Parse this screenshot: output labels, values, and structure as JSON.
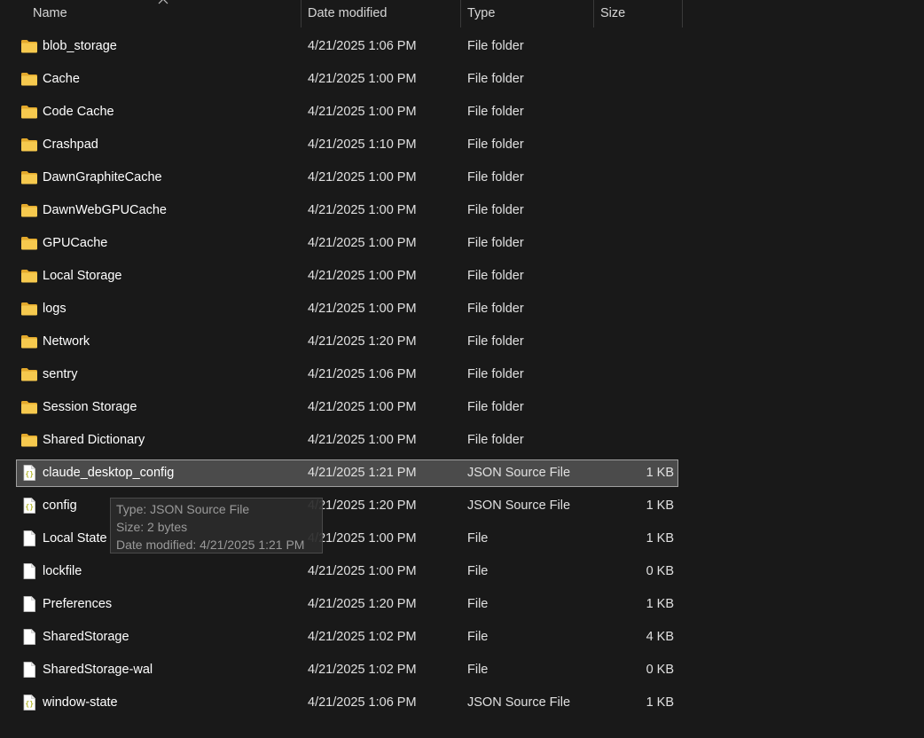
{
  "columns": {
    "name": "Name",
    "date": "Date modified",
    "type": "Type",
    "size": "Size"
  },
  "icons": {
    "folder": "folder-icon",
    "json": "json-file-icon",
    "file": "generic-file-icon"
  },
  "colors": {
    "folder": "#f6c94e",
    "folder_dark": "#e3a92c",
    "json_accent": "#b5b830",
    "selection_bg": "#4b4b4b",
    "selection_border": "#a0a0a0"
  },
  "files": [
    {
      "name": "blob_storage",
      "date": "4/21/2025 1:06 PM",
      "type": "File folder",
      "size": "",
      "icon": "folder"
    },
    {
      "name": "Cache",
      "date": "4/21/2025 1:00 PM",
      "type": "File folder",
      "size": "",
      "icon": "folder"
    },
    {
      "name": "Code Cache",
      "date": "4/21/2025 1:00 PM",
      "type": "File folder",
      "size": "",
      "icon": "folder"
    },
    {
      "name": "Crashpad",
      "date": "4/21/2025 1:10 PM",
      "type": "File folder",
      "size": "",
      "icon": "folder"
    },
    {
      "name": "DawnGraphiteCache",
      "date": "4/21/2025 1:00 PM",
      "type": "File folder",
      "size": "",
      "icon": "folder"
    },
    {
      "name": "DawnWebGPUCache",
      "date": "4/21/2025 1:00 PM",
      "type": "File folder",
      "size": "",
      "icon": "folder"
    },
    {
      "name": "GPUCache",
      "date": "4/21/2025 1:00 PM",
      "type": "File folder",
      "size": "",
      "icon": "folder"
    },
    {
      "name": "Local Storage",
      "date": "4/21/2025 1:00 PM",
      "type": "File folder",
      "size": "",
      "icon": "folder"
    },
    {
      "name": "logs",
      "date": "4/21/2025 1:00 PM",
      "type": "File folder",
      "size": "",
      "icon": "folder"
    },
    {
      "name": "Network",
      "date": "4/21/2025 1:20 PM",
      "type": "File folder",
      "size": "",
      "icon": "folder"
    },
    {
      "name": "sentry",
      "date": "4/21/2025 1:06 PM",
      "type": "File folder",
      "size": "",
      "icon": "folder"
    },
    {
      "name": "Session Storage",
      "date": "4/21/2025 1:00 PM",
      "type": "File folder",
      "size": "",
      "icon": "folder"
    },
    {
      "name": "Shared Dictionary",
      "date": "4/21/2025 1:00 PM",
      "type": "File folder",
      "size": "",
      "icon": "folder"
    },
    {
      "name": "claude_desktop_config",
      "date": "4/21/2025 1:21 PM",
      "type": "JSON Source File",
      "size": "1 KB",
      "icon": "json",
      "selected": true
    },
    {
      "name": "config",
      "date": "4/21/2025 1:20 PM",
      "type": "JSON Source File",
      "size": "1 KB",
      "icon": "json"
    },
    {
      "name": "Local State",
      "date": "4/21/2025 1:00 PM",
      "type": "File",
      "size": "1 KB",
      "icon": "file"
    },
    {
      "name": "lockfile",
      "date": "4/21/2025 1:00 PM",
      "type": "File",
      "size": "0 KB",
      "icon": "file"
    },
    {
      "name": "Preferences",
      "date": "4/21/2025 1:20 PM",
      "type": "File",
      "size": "1 KB",
      "icon": "file"
    },
    {
      "name": "SharedStorage",
      "date": "4/21/2025 1:02 PM",
      "type": "File",
      "size": "4 KB",
      "icon": "file"
    },
    {
      "name": "SharedStorage-wal",
      "date": "4/21/2025 1:02 PM",
      "type": "File",
      "size": "0 KB",
      "icon": "file"
    },
    {
      "name": "window-state",
      "date": "4/21/2025 1:06 PM",
      "type": "JSON Source File",
      "size": "1 KB",
      "icon": "json"
    }
  ],
  "tooltip": {
    "type_line": "Type: JSON Source File",
    "size_line": "Size: 2 bytes",
    "date_line": "Date modified: 4/21/2025 1:21 PM"
  }
}
